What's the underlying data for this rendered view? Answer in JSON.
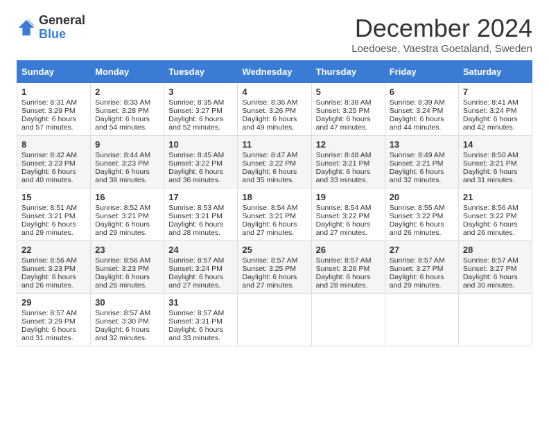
{
  "header": {
    "logo_general": "General",
    "logo_blue": "Blue",
    "title": "December 2024",
    "location": "Loedoese, Vaestra Goetaland, Sweden"
  },
  "days_of_week": [
    "Sunday",
    "Monday",
    "Tuesday",
    "Wednesday",
    "Thursday",
    "Friday",
    "Saturday"
  ],
  "weeks": [
    [
      {
        "day": "1",
        "sunrise": "Sunrise: 8:31 AM",
        "sunset": "Sunset: 3:29 PM",
        "daylight": "Daylight: 6 hours and 57 minutes."
      },
      {
        "day": "2",
        "sunrise": "Sunrise: 8:33 AM",
        "sunset": "Sunset: 3:28 PM",
        "daylight": "Daylight: 6 hours and 54 minutes."
      },
      {
        "day": "3",
        "sunrise": "Sunrise: 8:35 AM",
        "sunset": "Sunset: 3:27 PM",
        "daylight": "Daylight: 6 hours and 52 minutes."
      },
      {
        "day": "4",
        "sunrise": "Sunrise: 8:36 AM",
        "sunset": "Sunset: 3:26 PM",
        "daylight": "Daylight: 6 hours and 49 minutes."
      },
      {
        "day": "5",
        "sunrise": "Sunrise: 8:38 AM",
        "sunset": "Sunset: 3:25 PM",
        "daylight": "Daylight: 6 hours and 47 minutes."
      },
      {
        "day": "6",
        "sunrise": "Sunrise: 8:39 AM",
        "sunset": "Sunset: 3:24 PM",
        "daylight": "Daylight: 6 hours and 44 minutes."
      },
      {
        "day": "7",
        "sunrise": "Sunrise: 8:41 AM",
        "sunset": "Sunset: 3:24 PM",
        "daylight": "Daylight: 6 hours and 42 minutes."
      }
    ],
    [
      {
        "day": "8",
        "sunrise": "Sunrise: 8:42 AM",
        "sunset": "Sunset: 3:23 PM",
        "daylight": "Daylight: 6 hours and 40 minutes."
      },
      {
        "day": "9",
        "sunrise": "Sunrise: 8:44 AM",
        "sunset": "Sunset: 3:23 PM",
        "daylight": "Daylight: 6 hours and 38 minutes."
      },
      {
        "day": "10",
        "sunrise": "Sunrise: 8:45 AM",
        "sunset": "Sunset: 3:22 PM",
        "daylight": "Daylight: 6 hours and 36 minutes."
      },
      {
        "day": "11",
        "sunrise": "Sunrise: 8:47 AM",
        "sunset": "Sunset: 3:22 PM",
        "daylight": "Daylight: 6 hours and 35 minutes."
      },
      {
        "day": "12",
        "sunrise": "Sunrise: 8:48 AM",
        "sunset": "Sunset: 3:21 PM",
        "daylight": "Daylight: 6 hours and 33 minutes."
      },
      {
        "day": "13",
        "sunrise": "Sunrise: 8:49 AM",
        "sunset": "Sunset: 3:21 PM",
        "daylight": "Daylight: 6 hours and 32 minutes."
      },
      {
        "day": "14",
        "sunrise": "Sunrise: 8:50 AM",
        "sunset": "Sunset: 3:21 PM",
        "daylight": "Daylight: 6 hours and 31 minutes."
      }
    ],
    [
      {
        "day": "15",
        "sunrise": "Sunrise: 8:51 AM",
        "sunset": "Sunset: 3:21 PM",
        "daylight": "Daylight: 6 hours and 29 minutes."
      },
      {
        "day": "16",
        "sunrise": "Sunrise: 8:52 AM",
        "sunset": "Sunset: 3:21 PM",
        "daylight": "Daylight: 6 hours and 29 minutes."
      },
      {
        "day": "17",
        "sunrise": "Sunrise: 8:53 AM",
        "sunset": "Sunset: 3:21 PM",
        "daylight": "Daylight: 6 hours and 28 minutes."
      },
      {
        "day": "18",
        "sunrise": "Sunrise: 8:54 AM",
        "sunset": "Sunset: 3:21 PM",
        "daylight": "Daylight: 6 hours and 27 minutes."
      },
      {
        "day": "19",
        "sunrise": "Sunrise: 8:54 AM",
        "sunset": "Sunset: 3:22 PM",
        "daylight": "Daylight: 6 hours and 27 minutes."
      },
      {
        "day": "20",
        "sunrise": "Sunrise: 8:55 AM",
        "sunset": "Sunset: 3:22 PM",
        "daylight": "Daylight: 6 hours and 26 minutes."
      },
      {
        "day": "21",
        "sunrise": "Sunrise: 8:56 AM",
        "sunset": "Sunset: 3:22 PM",
        "daylight": "Daylight: 6 hours and 26 minutes."
      }
    ],
    [
      {
        "day": "22",
        "sunrise": "Sunrise: 8:56 AM",
        "sunset": "Sunset: 3:23 PM",
        "daylight": "Daylight: 6 hours and 26 minutes."
      },
      {
        "day": "23",
        "sunrise": "Sunrise: 8:56 AM",
        "sunset": "Sunset: 3:23 PM",
        "daylight": "Daylight: 6 hours and 26 minutes."
      },
      {
        "day": "24",
        "sunrise": "Sunrise: 8:57 AM",
        "sunset": "Sunset: 3:24 PM",
        "daylight": "Daylight: 6 hours and 27 minutes."
      },
      {
        "day": "25",
        "sunrise": "Sunrise: 8:57 AM",
        "sunset": "Sunset: 3:25 PM",
        "daylight": "Daylight: 6 hours and 27 minutes."
      },
      {
        "day": "26",
        "sunrise": "Sunrise: 8:57 AM",
        "sunset": "Sunset: 3:26 PM",
        "daylight": "Daylight: 6 hours and 28 minutes."
      },
      {
        "day": "27",
        "sunrise": "Sunrise: 8:57 AM",
        "sunset": "Sunset: 3:27 PM",
        "daylight": "Daylight: 6 hours and 29 minutes."
      },
      {
        "day": "28",
        "sunrise": "Sunrise: 8:57 AM",
        "sunset": "Sunset: 3:27 PM",
        "daylight": "Daylight: 6 hours and 30 minutes."
      }
    ],
    [
      {
        "day": "29",
        "sunrise": "Sunrise: 8:57 AM",
        "sunset": "Sunset: 3:29 PM",
        "daylight": "Daylight: 6 hours and 31 minutes."
      },
      {
        "day": "30",
        "sunrise": "Sunrise: 8:57 AM",
        "sunset": "Sunset: 3:30 PM",
        "daylight": "Daylight: 6 hours and 32 minutes."
      },
      {
        "day": "31",
        "sunrise": "Sunrise: 8:57 AM",
        "sunset": "Sunset: 3:31 PM",
        "daylight": "Daylight: 6 hours and 33 minutes."
      },
      null,
      null,
      null,
      null
    ]
  ]
}
